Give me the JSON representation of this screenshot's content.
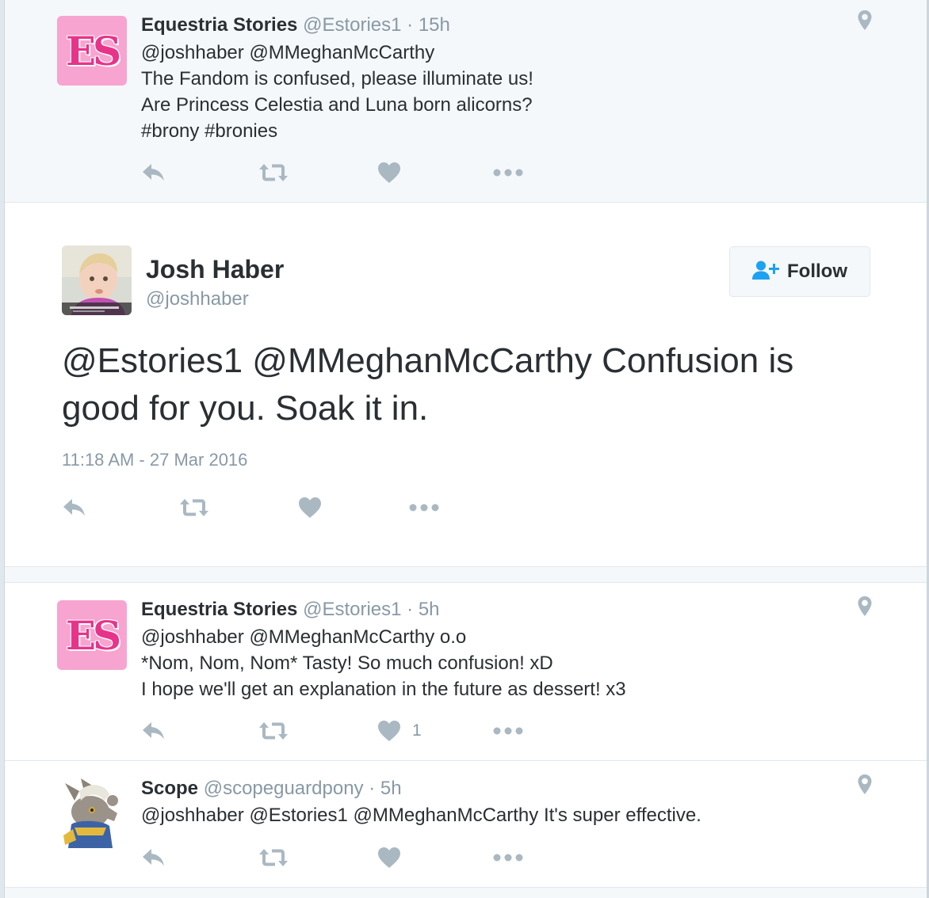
{
  "reply_context": {
    "name": "Equestria Stories",
    "handle": "@Estories1",
    "separator": "·",
    "time": "15h",
    "avatar_letters": "ES",
    "lines": [
      "@joshhaber @MMeghanMcCarthy",
      "The Fandom is confused, please illuminate us!",
      "Are Princess Celestia and Luna born alicorns?",
      "#brony #bronies"
    ]
  },
  "main_tweet": {
    "name": "Josh Haber",
    "handle": "@joshhaber",
    "follow_label": "Follow",
    "text_line1": "@Estories1 @MMeghanMcCarthy Confusion is",
    "text_line2": "good for you. Soak it in.",
    "timestamp": "11:18 AM - 27 Mar 2016"
  },
  "replies": [
    {
      "name": "Equestria Stories",
      "handle": "@Estories1",
      "separator": "·",
      "time": "5h",
      "avatar_letters": "ES",
      "lines": [
        "@joshhaber @MMeghanMcCarthy o.o",
        "*Nom, Nom, Nom* Tasty! So much confusion! xD",
        "I hope we'll get an explanation in the future as dessert! x3"
      ],
      "like_count": "1"
    },
    {
      "name": "Scope",
      "handle": "@scopeguardpony",
      "separator": "·",
      "time": "5h",
      "lines": [
        "@joshhaber @Estories1 @MMeghanMcCarthy It's super effective."
      ]
    }
  ],
  "icons": {
    "reply": "reply-icon",
    "retweet": "retweet-icon",
    "like": "heart-icon",
    "more": "more-icon",
    "location": "location-pin-icon",
    "follow": "add-user-icon"
  },
  "colors": {
    "icon_gray": "#aab8c2",
    "muted_text": "#8899a6",
    "follow_icon_blue": "#1da1f2",
    "es_pink": "#e8338b",
    "es_bg": "#f7a4d0"
  }
}
